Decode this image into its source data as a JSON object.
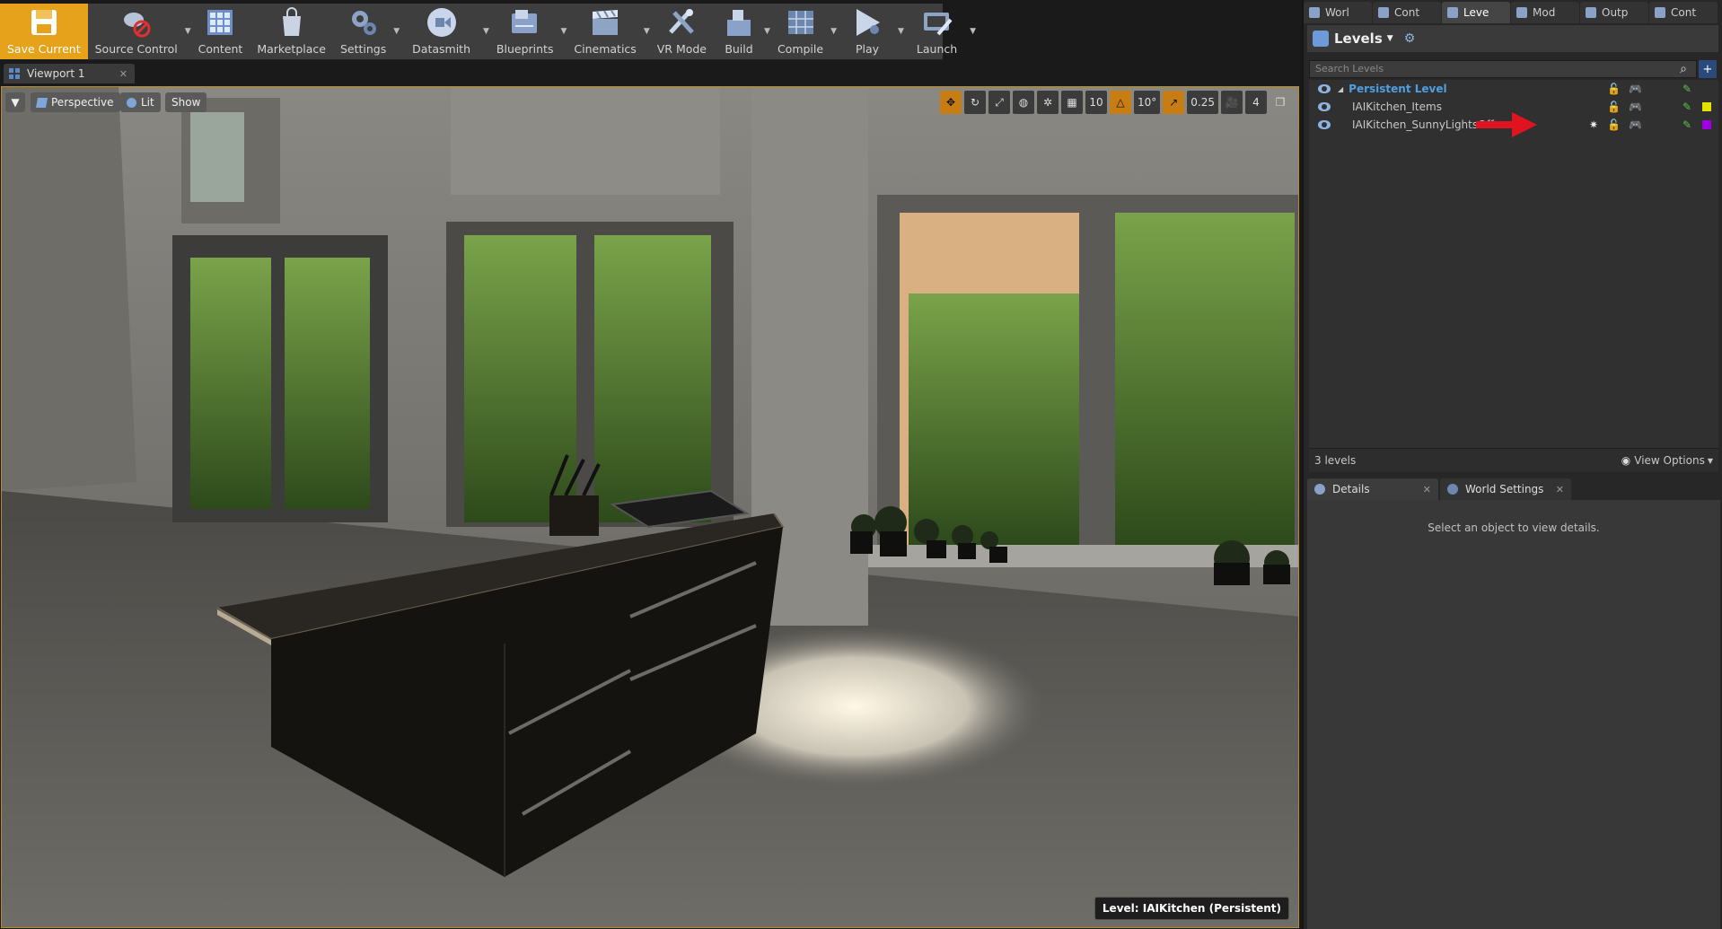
{
  "toolbar": {
    "buttons": [
      {
        "label": "Save Current",
        "icon": "save-disk-icon"
      },
      {
        "label": "Source Control",
        "icon": "source-control-icon"
      },
      {
        "label": "Content",
        "icon": "content-grid-icon"
      },
      {
        "label": "Marketplace",
        "icon": "marketplace-bag-icon"
      },
      {
        "label": "Settings",
        "icon": "settings-gears-icon"
      },
      {
        "label": "Datasmith",
        "icon": "datasmith-icon"
      },
      {
        "label": "Blueprints",
        "icon": "blueprints-icon"
      },
      {
        "label": "Cinematics",
        "icon": "clapperboard-icon"
      },
      {
        "label": "VR Mode",
        "icon": "vr-headset-icon"
      },
      {
        "label": "Build",
        "icon": "build-blocks-icon"
      },
      {
        "label": "Compile",
        "icon": "compile-cubes-icon"
      },
      {
        "label": "Play",
        "icon": "play-icon"
      },
      {
        "label": "Launch",
        "icon": "launch-icon"
      }
    ]
  },
  "viewport": {
    "tab_label": "Viewport 1",
    "perspective": "Perspective",
    "lit": "Lit",
    "show": "Show",
    "grid_snap": "10",
    "rotation_snap": "10°",
    "scale_snap": "0.25",
    "camera_speed": "4",
    "level_label": "Level:  IAIKitchen (Persistent)"
  },
  "panel_tabs": [
    "Worl",
    "Cont",
    "Leve",
    "Mod",
    "Outp",
    "Cont"
  ],
  "levels": {
    "title": "Levels",
    "search_placeholder": "Search Levels",
    "items": [
      {
        "name": "Persistent Level",
        "color": ""
      },
      {
        "name": "IAIKitchen_Items",
        "color": "#e6e200"
      },
      {
        "name": "IAIKitchen_SunnyLightsOff",
        "color": "#a000e0"
      }
    ],
    "count": "3 levels",
    "view_options": "View Options"
  },
  "details": {
    "tab_details": "Details",
    "tab_world": "World Settings",
    "message": "Select an object to view details."
  },
  "colors": {
    "accent": "#e6a21a",
    "persistent": "#4f9fe0",
    "arrow": "#e0141e"
  }
}
